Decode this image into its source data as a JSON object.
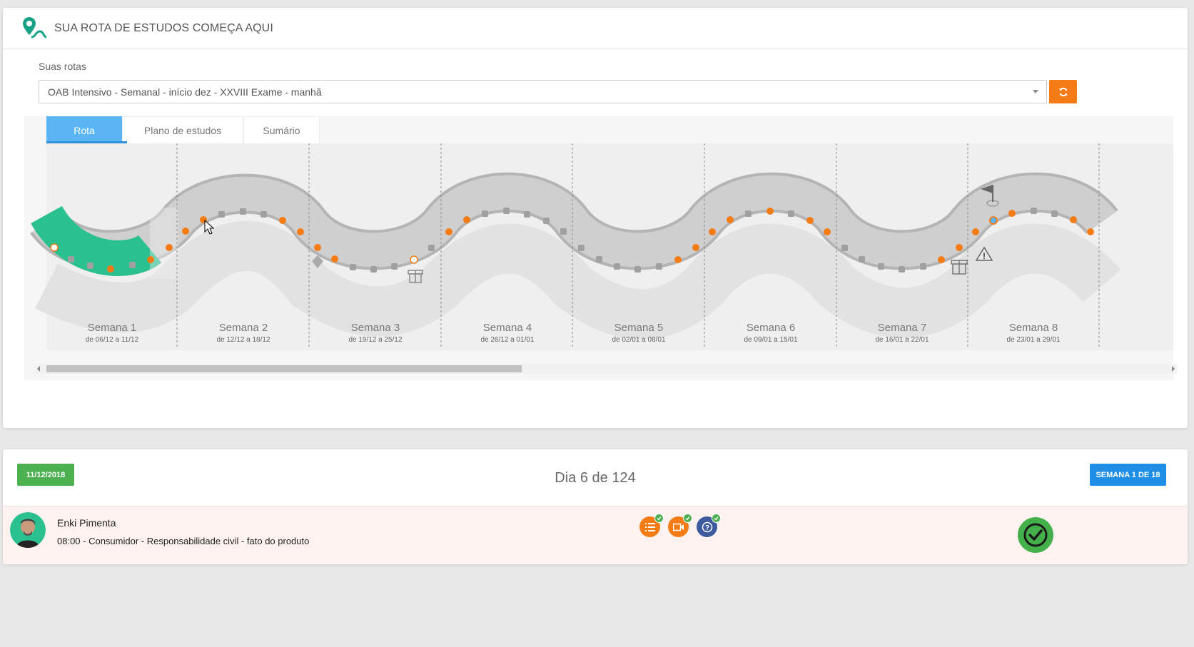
{
  "header": {
    "title": "SUA ROTA DE ESTUDOS COMEÇA AQUI"
  },
  "routes": {
    "label": "Suas rotas",
    "selected": "OAB Intensivo - Semanal - início dez - XXVIII Exame - manhã"
  },
  "tabs": [
    {
      "label": "Rota",
      "active": true
    },
    {
      "label": "Plano de estudos",
      "active": false
    },
    {
      "label": "Sumário",
      "active": false
    }
  ],
  "weeks": [
    {
      "label": "Semana 1",
      "range": "de 06/12 a 11/12"
    },
    {
      "label": "Semana 2",
      "range": "de 12/12 a 18/12"
    },
    {
      "label": "Semana 3",
      "range": "de 19/12 a 25/12"
    },
    {
      "label": "Semana 4",
      "range": "de 26/12 a 01/01"
    },
    {
      "label": "Semana 5",
      "range": "de 02/01 a 08/01"
    },
    {
      "label": "Semana 6",
      "range": "de 09/01 a 15/01"
    },
    {
      "label": "Semana 7",
      "range": "de 16/01 a 22/01"
    },
    {
      "label": "Semana 8",
      "range": "de 23/01 a 29/01"
    }
  ],
  "day": {
    "date": "11/12/2018",
    "title": "Dia 6 de 124",
    "week_badge": "SEMANA 1 DE 18"
  },
  "task": {
    "teacher": "Enki Pimenta",
    "description": "08:00 - Consumidor - Responsabilidade civil - fato do produto",
    "resources": [
      "list-icon",
      "video-icon",
      "question-icon"
    ],
    "completed": true
  },
  "colors": {
    "accent_orange": "#f57c14",
    "tab_blue": "#5bb5f5",
    "progress_green": "#2bc08f",
    "badge_green": "#4caf50",
    "badge_blue": "#1e8ee6"
  }
}
